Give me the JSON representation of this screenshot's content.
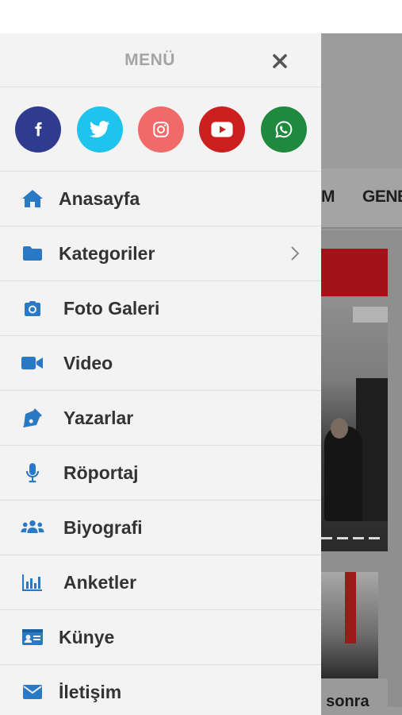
{
  "background": {
    "nav_left_fragment": "M",
    "nav_right_fragment": "GENE",
    "caption_fragment": "ı sonra",
    "accent_red": "#a11318"
  },
  "drawer": {
    "title": "MENÜ",
    "close_icon": "close-icon",
    "social": [
      {
        "name": "facebook",
        "icon": "facebook-icon",
        "color": "#2f3b8f"
      },
      {
        "name": "twitter",
        "icon": "twitter-icon",
        "color": "#1ec3ee"
      },
      {
        "name": "instagram",
        "icon": "instagram-icon",
        "color": "#f06a6a"
      },
      {
        "name": "youtube",
        "icon": "youtube-icon",
        "color": "#cc1f1f"
      },
      {
        "name": "whatsapp",
        "icon": "whatsapp-icon",
        "color": "#1f8a3e"
      }
    ],
    "icon_color": "#2a79c4",
    "items": [
      {
        "label": "Anasayfa",
        "icon": "home-icon"
      },
      {
        "label": "Kategoriler",
        "icon": "folder-icon",
        "has_submenu": true
      },
      {
        "label": "Foto Galeri",
        "icon": "camera-icon"
      },
      {
        "label": "Video",
        "icon": "video-camera-icon"
      },
      {
        "label": "Yazarlar",
        "icon": "pen-icon"
      },
      {
        "label": "Röportaj",
        "icon": "microphone-icon"
      },
      {
        "label": "Biyografi",
        "icon": "users-icon"
      },
      {
        "label": "Anketler",
        "icon": "bar-chart-icon"
      },
      {
        "label": "Künye",
        "icon": "id-card-icon"
      },
      {
        "label": "İletişim",
        "icon": "envelope-icon"
      }
    ]
  }
}
